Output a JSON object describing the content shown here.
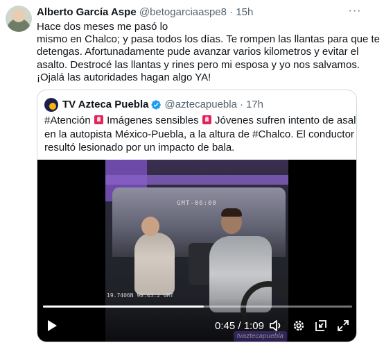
{
  "author": {
    "display_name": "Alberto García Aspe",
    "handle": "@betogarciaaspe8",
    "separator": "·",
    "time": "15h"
  },
  "more_label": "···",
  "tweet_lines": [
    "Hace dos meses me pasó lo",
    "mismo en Chalco; y pasa todos los días. Te rompen las llantas para que te",
    "detengas. Afortunadamente pude avanzar varios kilometros y evitar el",
    "asalto. Destrocé las llantas y rines pero mi esposa y yo nos salvamos.",
    "¡Ojalá las autoridades hagan algo YA!"
  ],
  "quote": {
    "name": "TV Azteca Puebla",
    "handle": "@aztecapuebla",
    "separator": "·",
    "time": "17h",
    "lines": {
      "line1_a": "#Atención",
      "line1_b": "Imágenes sensibles",
      "line1_c": "Jóvenes sufren intento de asalto",
      "line2": "en la autopista México-Puebla, a la altura de #Chalco. El conductor",
      "line3": "resultó lesionado por un impacto de bala."
    },
    "emoji_names": [
      "rotating-light-icon",
      "rotating-light-icon",
      "rotating-light-icon"
    ]
  },
  "video": {
    "stamp_top": "GMT-06:00",
    "stamp_bottom": "19.7406N 98.43.2 GMT",
    "brand": "tvaztecapuebla",
    "progress": 0.52,
    "current_time": "0:45",
    "duration": "1:09",
    "time_separator": "/",
    "icons": [
      "play-icon",
      "volume-icon",
      "settings-icon",
      "picture-in-picture-icon",
      "fullscreen-icon"
    ]
  },
  "colors": {
    "text": "#0f1419",
    "secondary": "#536471",
    "border": "#cfd9de",
    "verified": "#1d9bf0"
  }
}
